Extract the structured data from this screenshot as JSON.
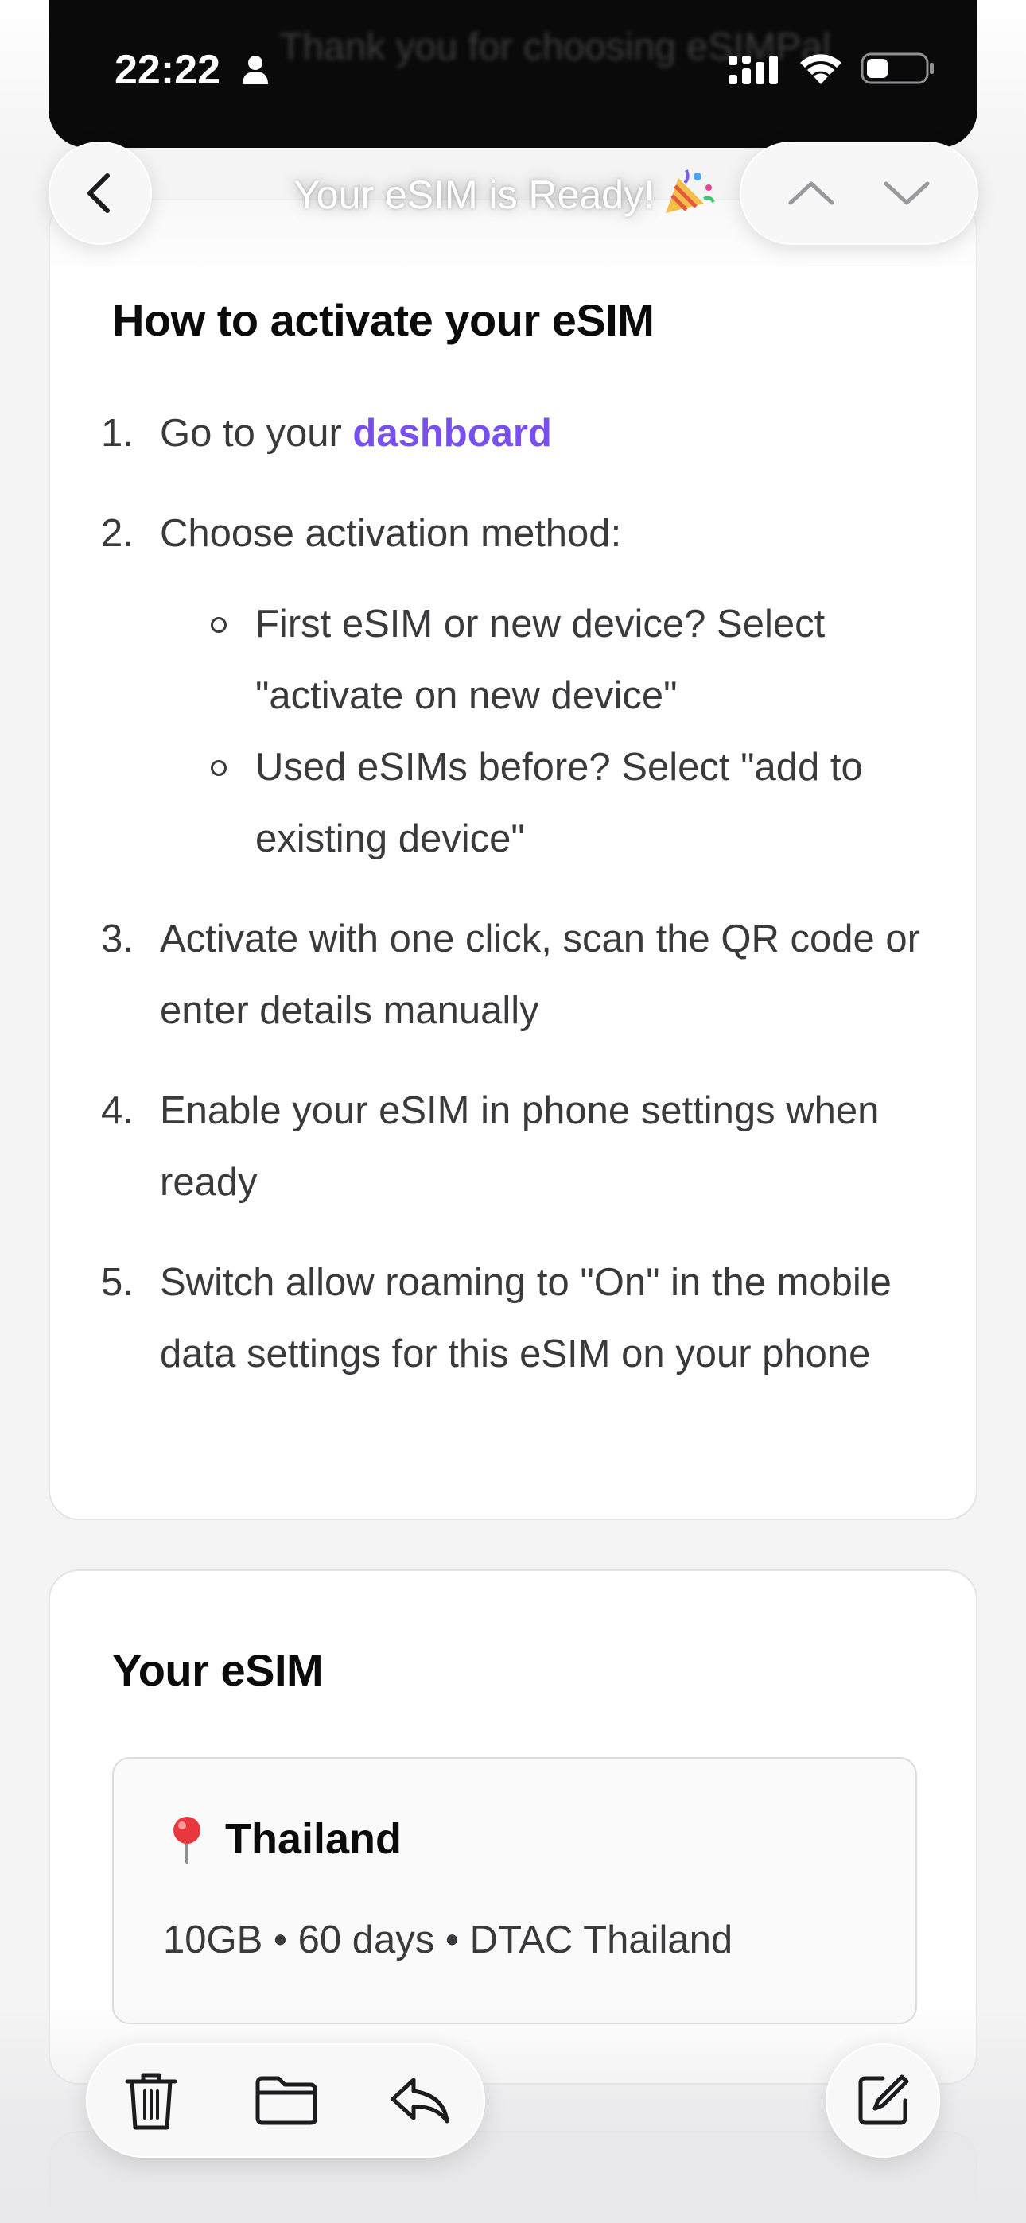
{
  "status_bar": {
    "time": "22:22",
    "icons": [
      "person-icon",
      "cellular-signal-icon",
      "wifi-icon",
      "battery-icon"
    ]
  },
  "background_header": "Thank you for choosing eSIMPal",
  "nav": {
    "title": "Your eSIM is Ready!",
    "title_emoji": "party-popper",
    "back_icon": "chevron-left-icon",
    "prev_icon": "chevron-up-icon",
    "next_icon": "chevron-down-icon"
  },
  "activation": {
    "heading": "How to activate your eSIM",
    "steps": [
      {
        "num": "1.",
        "text": "Go to your ",
        "link": "dashboard"
      },
      {
        "num": "2.",
        "text": "Choose activation method:"
      },
      {
        "num": "3.",
        "text": "Activate with one click, scan the QR code or enter details manually"
      },
      {
        "num": "4.",
        "text": "Enable your eSIM in phone settings when ready"
      },
      {
        "num": "5.",
        "text": "Switch allow roaming to \"On\" in the mobile data settings for this eSIM on your phone"
      }
    ],
    "sub_options": [
      "First eSIM or new device? Select \"activate on new device\"",
      "Used eSIMs before? Select \"add to existing device\""
    ]
  },
  "esim": {
    "heading": "Your eSIM",
    "country": "Thailand",
    "country_icon": "round-pushpin",
    "plan": "10GB • 60 days • DTAC Thailand"
  },
  "toolbar": {
    "icons": [
      "trash-icon",
      "folder-icon",
      "reply-icon",
      "compose-icon"
    ]
  },
  "colors": {
    "link": "#7a4ff0",
    "text": "#3a3a3c",
    "heading": "#0b0b0c",
    "background": "#f4f4f5"
  }
}
